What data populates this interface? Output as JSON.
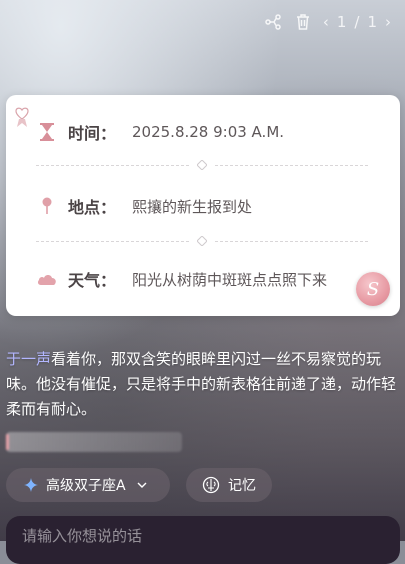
{
  "toolbar": {
    "page_current": "1",
    "page_separator": "/",
    "page_total": "1",
    "icons": [
      "branch-icon",
      "trash-icon",
      "chevron-left-icon",
      "chevron-right-icon"
    ]
  },
  "info_card": {
    "time": {
      "label": "时间：",
      "value": "2025.8.28  9:03 A.M.",
      "icon": "hourglass-icon"
    },
    "location": {
      "label": "地点：",
      "value": "熙攘的新生报到处",
      "icon": "pin-icon"
    },
    "weather": {
      "label": "天气：",
      "value": "阳光从树荫中斑斑点点照下来",
      "icon": "cloud-icon"
    },
    "avatar_letter": "S"
  },
  "story": {
    "name": "于一声",
    "text": "看着你，那双含笑的眼眸里闪过一丝不易察觉的玩味。他没有催促，只是将手中的新表格往前递了递，动作轻柔而有耐心。"
  },
  "chips": {
    "model_label": "高级双子座A",
    "memory_label": "记忆"
  },
  "input": {
    "placeholder": "请输入你想说的话"
  },
  "colors": {
    "card_bg": "#ffffff",
    "accent_pink": "#e79aa3",
    "name_color": "#b3b6ff",
    "input_bg": "#2a2131"
  }
}
